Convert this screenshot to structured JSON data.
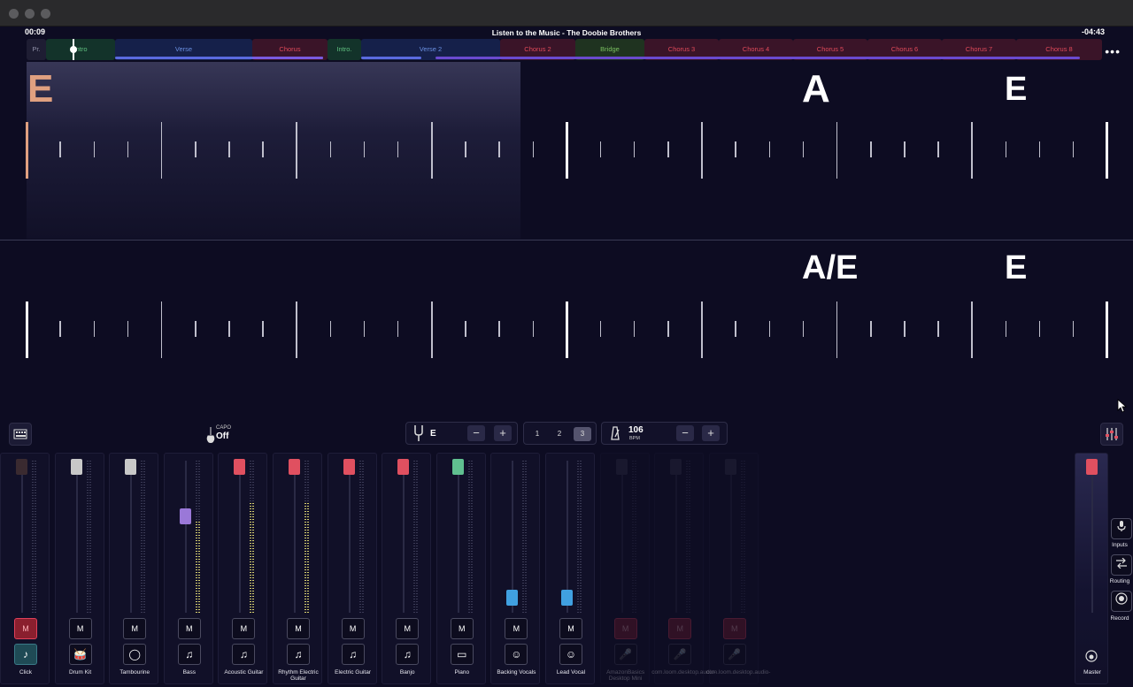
{
  "header": {
    "elapsed": "00:09",
    "remaining": "-04:43",
    "title": "Listen to the Music - The Doobie Brothers",
    "more": "•••"
  },
  "sections": [
    {
      "label": "Pr.",
      "color": "#9090a8",
      "bg": "#1e1d33"
    },
    {
      "label": "Intro",
      "color": "#60c080",
      "bg": "#13332a"
    },
    {
      "label": "Verse",
      "color": "#6a8fe0",
      "bg": "#15204a"
    },
    {
      "label": "Chorus",
      "color": "#e04a5a",
      "bg": "#3a1428"
    },
    {
      "label": "Intro.",
      "color": "#60c080",
      "bg": "#13332a"
    },
    {
      "label": "Verse 2",
      "color": "#6a8fe0",
      "bg": "#15204a"
    },
    {
      "label": "Chorus 2",
      "color": "#e04a5a",
      "bg": "#3a1428"
    },
    {
      "label": "Bridge",
      "color": "#7ac060",
      "bg": "#1f3320"
    },
    {
      "label": "Chorus 3",
      "color": "#e04a5a",
      "bg": "#3a1428"
    },
    {
      "label": "Chorus 4",
      "color": "#e04a5a",
      "bg": "#3a1428"
    },
    {
      "label": "Chorus 5",
      "color": "#e04a5a",
      "bg": "#3a1428"
    },
    {
      "label": "Chorus 6",
      "color": "#e04a5a",
      "bg": "#3a1428"
    },
    {
      "label": "Chorus 7",
      "color": "#e04a5a",
      "bg": "#3a1428"
    },
    {
      "label": "Chorus 8",
      "color": "#e04a5a",
      "bg": "#3a1428"
    }
  ],
  "chords": {
    "row1": [
      "E",
      "A",
      "E"
    ],
    "row2": [
      "A/E",
      "E"
    ]
  },
  "toolbar": {
    "capo_label": "CAPO",
    "capo_value": "Off",
    "key": "E",
    "minus": "−",
    "plus": "+",
    "count_options": [
      "1",
      "2",
      "3"
    ],
    "count_selected": "3",
    "bpm": "106",
    "bpm_unit": "BPM"
  },
  "mixer": {
    "mute_label": "M",
    "tracks": [
      {
        "name": "Click",
        "icon": "♪",
        "cap_color": "#3a2a30",
        "level": 1.0,
        "meter": 0,
        "muted": true,
        "dim": false
      },
      {
        "name": "Drum Kit",
        "icon": "🥁",
        "cap_color": "#c8c8c8",
        "level": 1.0,
        "meter": 0,
        "muted": false,
        "dim": false
      },
      {
        "name": "Tambourine",
        "icon": "◯",
        "cap_color": "#c8c8c8",
        "level": 1.0,
        "meter": 0,
        "muted": false,
        "dim": false
      },
      {
        "name": "Bass",
        "icon": "♫",
        "cap_color": "#9a78d8",
        "level": 0.64,
        "meter": 0.6,
        "muted": false,
        "dim": false
      },
      {
        "name": "Acoustic Guitar",
        "icon": "♫",
        "cap_color": "#e05060",
        "level": 1.0,
        "meter": 0.72,
        "muted": false,
        "dim": false
      },
      {
        "name": "Rhythm Electric Guitar",
        "icon": "♫",
        "cap_color": "#e05060",
        "level": 1.0,
        "meter": 0.72,
        "muted": false,
        "dim": false
      },
      {
        "name": "Electric Guitar",
        "icon": "♫",
        "cap_color": "#e05060",
        "level": 1.0,
        "meter": 0,
        "muted": false,
        "dim": false
      },
      {
        "name": "Banjo",
        "icon": "♫",
        "cap_color": "#e05060",
        "level": 1.0,
        "meter": 0,
        "muted": false,
        "dim": false
      },
      {
        "name": "Piano",
        "icon": "▭",
        "cap_color": "#60c090",
        "level": 1.0,
        "meter": 0,
        "muted": false,
        "dim": false
      },
      {
        "name": "Backing Vocals",
        "icon": "☺",
        "cap_color": "#40a0e0",
        "level": 0.05,
        "meter": 0,
        "muted": false,
        "dim": false
      },
      {
        "name": "Lead Vocal",
        "icon": "☺",
        "cap_color": "#40a0e0",
        "level": 0.05,
        "meter": 0,
        "muted": false,
        "dim": false
      },
      {
        "name": "AmazonBasics Desktop Mini",
        "icon": "🎤",
        "cap_color": "#3a3a50",
        "level": 1.0,
        "meter": 0,
        "muted": true,
        "dim": true
      },
      {
        "name": "com.loom.desktop.audio-",
        "icon": "🎤",
        "cap_color": "#3a3a50",
        "level": 1.0,
        "meter": 0,
        "muted": true,
        "dim": true
      },
      {
        "name": "com.loom.desktop.audio-",
        "icon": "🎤",
        "cap_color": "#3a3a50",
        "level": 1.0,
        "meter": 0,
        "muted": true,
        "dim": true
      }
    ],
    "master": {
      "name": "Master",
      "cap_color": "#e05060"
    }
  },
  "side": {
    "inputs": "Inputs",
    "routing": "Routing",
    "record": "Record"
  }
}
